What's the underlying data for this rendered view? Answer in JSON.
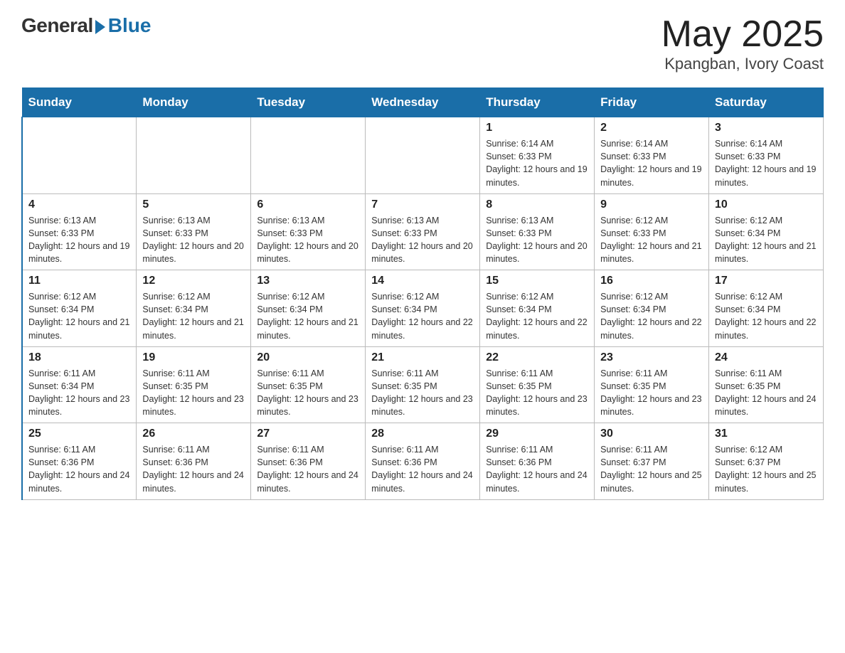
{
  "logo": {
    "general": "General",
    "blue": "Blue"
  },
  "title": {
    "month_year": "May 2025",
    "location": "Kpangban, Ivory Coast"
  },
  "days_of_week": [
    "Sunday",
    "Monday",
    "Tuesday",
    "Wednesday",
    "Thursday",
    "Friday",
    "Saturday"
  ],
  "weeks": [
    [
      {
        "day": "",
        "info": ""
      },
      {
        "day": "",
        "info": ""
      },
      {
        "day": "",
        "info": ""
      },
      {
        "day": "",
        "info": ""
      },
      {
        "day": "1",
        "info": "Sunrise: 6:14 AM\nSunset: 6:33 PM\nDaylight: 12 hours and 19 minutes."
      },
      {
        "day": "2",
        "info": "Sunrise: 6:14 AM\nSunset: 6:33 PM\nDaylight: 12 hours and 19 minutes."
      },
      {
        "day": "3",
        "info": "Sunrise: 6:14 AM\nSunset: 6:33 PM\nDaylight: 12 hours and 19 minutes."
      }
    ],
    [
      {
        "day": "4",
        "info": "Sunrise: 6:13 AM\nSunset: 6:33 PM\nDaylight: 12 hours and 19 minutes."
      },
      {
        "day": "5",
        "info": "Sunrise: 6:13 AM\nSunset: 6:33 PM\nDaylight: 12 hours and 20 minutes."
      },
      {
        "day": "6",
        "info": "Sunrise: 6:13 AM\nSunset: 6:33 PM\nDaylight: 12 hours and 20 minutes."
      },
      {
        "day": "7",
        "info": "Sunrise: 6:13 AM\nSunset: 6:33 PM\nDaylight: 12 hours and 20 minutes."
      },
      {
        "day": "8",
        "info": "Sunrise: 6:13 AM\nSunset: 6:33 PM\nDaylight: 12 hours and 20 minutes."
      },
      {
        "day": "9",
        "info": "Sunrise: 6:12 AM\nSunset: 6:33 PM\nDaylight: 12 hours and 21 minutes."
      },
      {
        "day": "10",
        "info": "Sunrise: 6:12 AM\nSunset: 6:34 PM\nDaylight: 12 hours and 21 minutes."
      }
    ],
    [
      {
        "day": "11",
        "info": "Sunrise: 6:12 AM\nSunset: 6:34 PM\nDaylight: 12 hours and 21 minutes."
      },
      {
        "day": "12",
        "info": "Sunrise: 6:12 AM\nSunset: 6:34 PM\nDaylight: 12 hours and 21 minutes."
      },
      {
        "day": "13",
        "info": "Sunrise: 6:12 AM\nSunset: 6:34 PM\nDaylight: 12 hours and 21 minutes."
      },
      {
        "day": "14",
        "info": "Sunrise: 6:12 AM\nSunset: 6:34 PM\nDaylight: 12 hours and 22 minutes."
      },
      {
        "day": "15",
        "info": "Sunrise: 6:12 AM\nSunset: 6:34 PM\nDaylight: 12 hours and 22 minutes."
      },
      {
        "day": "16",
        "info": "Sunrise: 6:12 AM\nSunset: 6:34 PM\nDaylight: 12 hours and 22 minutes."
      },
      {
        "day": "17",
        "info": "Sunrise: 6:12 AM\nSunset: 6:34 PM\nDaylight: 12 hours and 22 minutes."
      }
    ],
    [
      {
        "day": "18",
        "info": "Sunrise: 6:11 AM\nSunset: 6:34 PM\nDaylight: 12 hours and 23 minutes."
      },
      {
        "day": "19",
        "info": "Sunrise: 6:11 AM\nSunset: 6:35 PM\nDaylight: 12 hours and 23 minutes."
      },
      {
        "day": "20",
        "info": "Sunrise: 6:11 AM\nSunset: 6:35 PM\nDaylight: 12 hours and 23 minutes."
      },
      {
        "day": "21",
        "info": "Sunrise: 6:11 AM\nSunset: 6:35 PM\nDaylight: 12 hours and 23 minutes."
      },
      {
        "day": "22",
        "info": "Sunrise: 6:11 AM\nSunset: 6:35 PM\nDaylight: 12 hours and 23 minutes."
      },
      {
        "day": "23",
        "info": "Sunrise: 6:11 AM\nSunset: 6:35 PM\nDaylight: 12 hours and 23 minutes."
      },
      {
        "day": "24",
        "info": "Sunrise: 6:11 AM\nSunset: 6:35 PM\nDaylight: 12 hours and 24 minutes."
      }
    ],
    [
      {
        "day": "25",
        "info": "Sunrise: 6:11 AM\nSunset: 6:36 PM\nDaylight: 12 hours and 24 minutes."
      },
      {
        "day": "26",
        "info": "Sunrise: 6:11 AM\nSunset: 6:36 PM\nDaylight: 12 hours and 24 minutes."
      },
      {
        "day": "27",
        "info": "Sunrise: 6:11 AM\nSunset: 6:36 PM\nDaylight: 12 hours and 24 minutes."
      },
      {
        "day": "28",
        "info": "Sunrise: 6:11 AM\nSunset: 6:36 PM\nDaylight: 12 hours and 24 minutes."
      },
      {
        "day": "29",
        "info": "Sunrise: 6:11 AM\nSunset: 6:36 PM\nDaylight: 12 hours and 24 minutes."
      },
      {
        "day": "30",
        "info": "Sunrise: 6:11 AM\nSunset: 6:37 PM\nDaylight: 12 hours and 25 minutes."
      },
      {
        "day": "31",
        "info": "Sunrise: 6:12 AM\nSunset: 6:37 PM\nDaylight: 12 hours and 25 minutes."
      }
    ]
  ]
}
